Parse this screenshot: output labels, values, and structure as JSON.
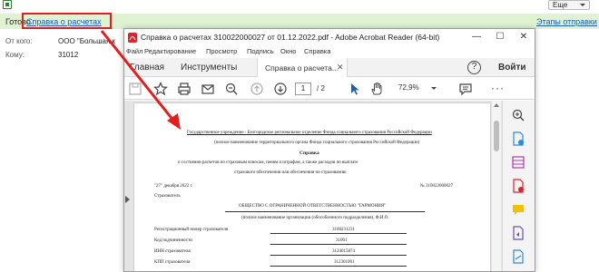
{
  "background_app": {
    "more_button": "Еще",
    "status": "Готово",
    "status_link": "Справка о расчетах",
    "stages_link": "Этапы отправки",
    "fields": [
      {
        "label": "От кого:",
        "value": "ООО \"Большая к"
      },
      {
        "label": "Кому:",
        "value": "31012"
      }
    ]
  },
  "reader": {
    "title": "Справка о расчетах 310022000027 от 01.12.2022.pdf - Adobe Acrobat Reader (64-bit)",
    "window_controls": {
      "minimize": "—",
      "maximize": "☐",
      "close": "✕"
    },
    "menu": [
      "Файл",
      "Редактирование",
      "Просмотр",
      "Подпись",
      "Окно",
      "Справка"
    ],
    "tabs": {
      "home": "Главная",
      "tools": "Инструменты",
      "document": "Справка о расчета..."
    },
    "signin": "Войти",
    "toolbar": {
      "page_current": "1",
      "page_total": "/  2",
      "zoom": "72,9%"
    },
    "colors": {
      "accent": "#1a5fb4",
      "red_box": "#e02020",
      "status_bg": "#dff3d2"
    }
  },
  "document": {
    "org_header": "Государственное учреждение - Белгородское региональное отделение Фонда социального страхования Российской Федерации",
    "org_caption": "(полное наименование территориального органа Фонда социального страхования Российской Федерации)",
    "doc_title": "Справка",
    "subject_1": "о состоянии расчетов по страховым взносам, пеням и штрафам, а также расходов по выплате",
    "subject_2": "страхового обеспечения или обеспечения по страхованию",
    "date": "\"27\" декабря 2022 г.",
    "number": "№ 310022000027",
    "insurer_label": "Страхователь",
    "company": "ОБЩЕСТВО С ОГРАНИЧЕННОЙ ОТВЕТСТВЕННОСТЬЮ \"ГАРМОНИЯ\"",
    "company_caption": "(полное наименование организации (обособленного подразделения), Ф.И.О.",
    "rows": [
      {
        "label": "Регистрационный номер страхователя",
        "value": "3100231231"
      },
      {
        "label": "Код подчиненности",
        "value": "31001"
      },
      {
        "label": "ИНН страхователя",
        "value": "3124015874"
      },
      {
        "label": "КПП страхователя",
        "value": "312301001"
      }
    ]
  }
}
